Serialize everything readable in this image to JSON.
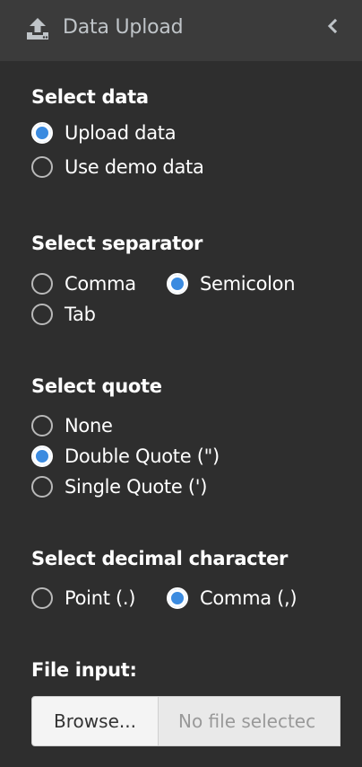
{
  "header": {
    "title": "Data Upload",
    "icon": "upload-icon",
    "collapse_icon": "chevron-left-icon"
  },
  "colors": {
    "background": "#2e2e2e",
    "header": "#3b3b3b",
    "accent": "#3b8be0"
  },
  "select_data": {
    "title": "Select data",
    "options": [
      {
        "label": "Upload data",
        "checked": true
      },
      {
        "label": "Use demo data",
        "checked": false
      }
    ]
  },
  "select_separator": {
    "title": "Select separator",
    "options": [
      {
        "label": "Comma",
        "checked": false
      },
      {
        "label": "Semicolon",
        "checked": true
      },
      {
        "label": "Tab",
        "checked": false
      }
    ]
  },
  "select_quote": {
    "title": "Select quote",
    "options": [
      {
        "label": "None",
        "checked": false
      },
      {
        "label": "Double Quote (\")",
        "checked": true
      },
      {
        "label": "Single Quote (')",
        "checked": false
      }
    ]
  },
  "select_decimal": {
    "title": "Select decimal character",
    "options": [
      {
        "label": "Point (.)",
        "checked": false
      },
      {
        "label": "Comma (,)",
        "checked": true
      }
    ]
  },
  "file_input": {
    "title": "File input:",
    "button_label": "Browse...",
    "placeholder": "No file selectec"
  }
}
